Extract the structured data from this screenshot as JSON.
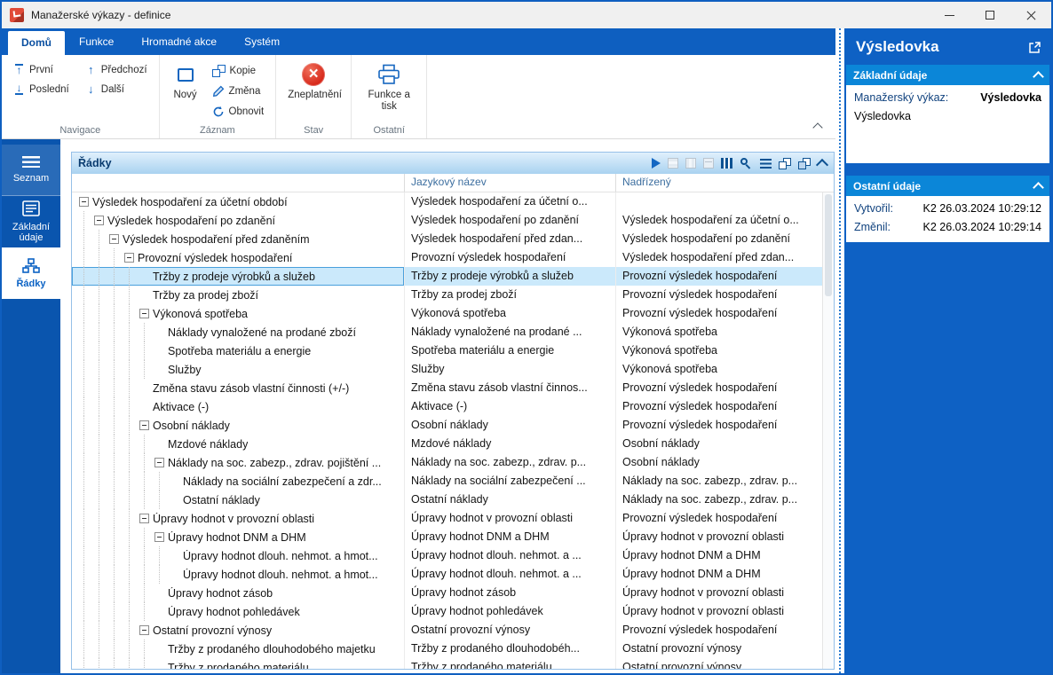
{
  "window": {
    "title": "Manažerské výkazy - definice"
  },
  "ribbon": {
    "tabs": [
      {
        "label": "Domů",
        "active": true
      },
      {
        "label": "Funkce",
        "active": false
      },
      {
        "label": "Hromadné akce",
        "active": false
      },
      {
        "label": "Systém",
        "active": false
      }
    ],
    "navigace": {
      "label": "Navigace",
      "first": "První",
      "last": "Poslední",
      "prev": "Předchozí",
      "next": "Další"
    },
    "zaznam": {
      "label": "Záznam",
      "new": "Nový",
      "copy": "Kopie",
      "change": "Změna",
      "refresh": "Obnovit"
    },
    "stav": {
      "label": "Stav",
      "invalidate": "Zneplatnění"
    },
    "ostatni": {
      "label": "Ostatní",
      "functions_print": "Funkce a tisk"
    }
  },
  "sidebar": {
    "items": [
      {
        "label": "Seznam",
        "icon": "menu-lines-icon",
        "active": false
      },
      {
        "label": "Základní údaje",
        "icon": "form-icon",
        "active": false
      },
      {
        "label": "Řádky",
        "icon": "rows-tree-icon",
        "active": true
      }
    ]
  },
  "grid": {
    "title": "Řádky",
    "columns": {
      "lang": "Jazykový název",
      "parent": "Nadřízený"
    },
    "toolbar": [
      {
        "name": "run",
        "disabled": false
      },
      {
        "name": "view-a",
        "disabled": true
      },
      {
        "name": "view-b",
        "disabled": true
      },
      {
        "name": "view-c",
        "disabled": true
      },
      {
        "name": "columns",
        "disabled": false
      },
      {
        "name": "zoom-settings",
        "disabled": false
      },
      {
        "name": "menu",
        "disabled": false
      },
      {
        "name": "new-window",
        "disabled": false
      },
      {
        "name": "duplicate-window",
        "disabled": false
      },
      {
        "name": "collapse",
        "disabled": false
      }
    ],
    "rows": [
      {
        "level": 0,
        "expandable": true,
        "selected": false,
        "name": "Výsledek hospodaření za účetní období",
        "lang": "Výsledek hospodaření za účetní o...",
        "parent": ""
      },
      {
        "level": 1,
        "expandable": true,
        "selected": false,
        "name": "Výsledek hospodaření po zdanění",
        "lang": "Výsledek hospodaření po zdanění",
        "parent": "Výsledek hospodaření za účetní o..."
      },
      {
        "level": 2,
        "expandable": true,
        "selected": false,
        "name": "Výsledek hospodaření před zdaněním",
        "lang": "Výsledek hospodaření před zdan...",
        "parent": "Výsledek hospodaření po zdanění"
      },
      {
        "level": 3,
        "expandable": true,
        "selected": false,
        "name": "Provozní výsledek hospodaření",
        "lang": "Provozní výsledek hospodaření",
        "parent": "Výsledek hospodaření před zdan..."
      },
      {
        "level": 4,
        "expandable": false,
        "selected": true,
        "name": "Tržby z prodeje výrobků a služeb",
        "lang": "Tržby z prodeje výrobků a služeb",
        "parent": "Provozní výsledek hospodaření"
      },
      {
        "level": 4,
        "expandable": false,
        "selected": false,
        "name": "Tržby za prodej zboží",
        "lang": "Tržby za prodej zboží",
        "parent": "Provozní výsledek hospodaření"
      },
      {
        "level": 4,
        "expandable": true,
        "selected": false,
        "name": "Výkonová spotřeba",
        "lang": "Výkonová spotřeba",
        "parent": "Provozní výsledek hospodaření"
      },
      {
        "level": 5,
        "expandable": false,
        "selected": false,
        "name": "Náklady vynaložené na prodané zboží",
        "lang": "Náklady vynaložené na prodané ...",
        "parent": "Výkonová spotřeba"
      },
      {
        "level": 5,
        "expandable": false,
        "selected": false,
        "name": "Spotřeba materiálu a energie",
        "lang": "Spotřeba materiálu a energie",
        "parent": "Výkonová spotřeba"
      },
      {
        "level": 5,
        "expandable": false,
        "selected": false,
        "name": "Služby",
        "lang": "Služby",
        "parent": "Výkonová spotřeba"
      },
      {
        "level": 4,
        "expandable": false,
        "selected": false,
        "name": "Změna stavu zásob vlastní činnosti (+/-)",
        "lang": "Změna stavu zásob vlastní činnos...",
        "parent": "Provozní výsledek hospodaření"
      },
      {
        "level": 4,
        "expandable": false,
        "selected": false,
        "name": "Aktivace (-)",
        "lang": "Aktivace (-)",
        "parent": "Provozní výsledek hospodaření"
      },
      {
        "level": 4,
        "expandable": true,
        "selected": false,
        "name": "Osobní náklady",
        "lang": "Osobní náklady",
        "parent": "Provozní výsledek hospodaření"
      },
      {
        "level": 5,
        "expandable": false,
        "selected": false,
        "name": "Mzdové náklady",
        "lang": "Mzdové náklady",
        "parent": "Osobní náklady"
      },
      {
        "level": 5,
        "expandable": true,
        "selected": false,
        "name": "Náklady na soc. zabezp., zdrav. pojištění ...",
        "lang": "Náklady na soc. zabezp., zdrav. p...",
        "parent": "Osobní náklady"
      },
      {
        "level": 6,
        "expandable": false,
        "selected": false,
        "name": "Náklady na sociální zabezpečení a zdr...",
        "lang": "Náklady na sociální zabezpečení ...",
        "parent": "Náklady na soc. zabezp., zdrav. p..."
      },
      {
        "level": 6,
        "expandable": false,
        "selected": false,
        "name": "Ostatní náklady",
        "lang": "Ostatní náklady",
        "parent": "Náklady na soc. zabezp., zdrav. p..."
      },
      {
        "level": 4,
        "expandable": true,
        "selected": false,
        "name": "Úpravy hodnot v provozní oblasti",
        "lang": "Úpravy hodnot v provozní oblasti",
        "parent": "Provozní výsledek hospodaření"
      },
      {
        "level": 5,
        "expandable": true,
        "selected": false,
        "name": "Úpravy hodnot DNM a DHM",
        "lang": "Úpravy hodnot DNM a DHM",
        "parent": "Úpravy hodnot v provozní oblasti"
      },
      {
        "level": 6,
        "expandable": false,
        "selected": false,
        "name": "Úpravy hodnot dlouh. nehmot. a hmot...",
        "lang": "Úpravy hodnot dlouh. nehmot. a ...",
        "parent": "Úpravy hodnot DNM a DHM"
      },
      {
        "level": 6,
        "expandable": false,
        "selected": false,
        "name": "Úpravy hodnot dlouh. nehmot. a hmot...",
        "lang": "Úpravy hodnot dlouh. nehmot. a ...",
        "parent": "Úpravy hodnot DNM a DHM"
      },
      {
        "level": 5,
        "expandable": false,
        "selected": false,
        "name": "Úpravy hodnot zásob",
        "lang": "Úpravy hodnot zásob",
        "parent": "Úpravy hodnot v provozní oblasti"
      },
      {
        "level": 5,
        "expandable": false,
        "selected": false,
        "name": "Úpravy hodnot pohledávek",
        "lang": "Úpravy hodnot pohledávek",
        "parent": "Úpravy hodnot v provozní oblasti"
      },
      {
        "level": 4,
        "expandable": true,
        "selected": false,
        "name": "Ostatní provozní výnosy",
        "lang": "Ostatní provozní výnosy",
        "parent": "Provozní výsledek hospodaření"
      },
      {
        "level": 5,
        "expandable": false,
        "selected": false,
        "name": "Tržby z prodaného dlouhodobého majetku",
        "lang": "Tržby z prodaného dlouhodobéh...",
        "parent": "Ostatní provozní výnosy"
      },
      {
        "level": 5,
        "expandable": false,
        "selected": false,
        "name": "Tržby z prodaného materiálu",
        "lang": "Tržby z prodaného materiálu",
        "parent": "Ostatní provozní výnosy"
      }
    ]
  },
  "panel": {
    "title": "Výsledovka",
    "basic": {
      "title": "Základní údaje",
      "report_label": "Manažerský výkaz:",
      "report_value": "Výsledovka",
      "description": "Výsledovka"
    },
    "other": {
      "title": "Ostatní údaje",
      "created_label": "Vytvořil:",
      "created_value": "K2 26.03.2024 10:29:12",
      "changed_label": "Změnil:",
      "changed_value": "K2 26.03.2024 10:29:14"
    }
  }
}
